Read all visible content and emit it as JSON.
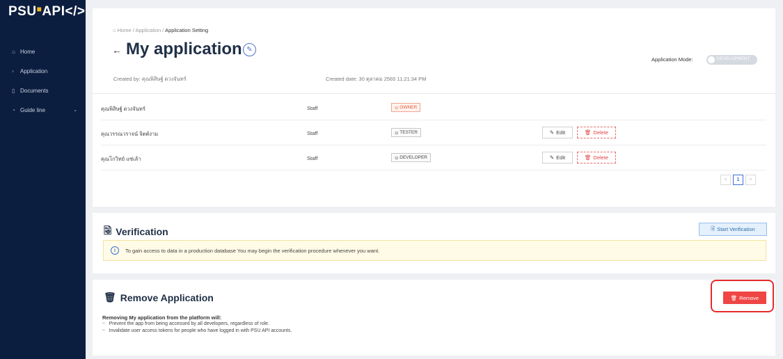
{
  "sidebar": {
    "logo": "PSU",
    "logo_suffix": "API</>",
    "items": [
      {
        "label": "Home",
        "icon": "home-icon"
      },
      {
        "label": "Application",
        "icon": "app-icon"
      },
      {
        "label": "Documents",
        "icon": "document-icon"
      },
      {
        "label": "Guide line",
        "icon": "clock-icon"
      }
    ]
  },
  "header": {
    "breadcrumb": {
      "home": "Home",
      "sep1": "/",
      "application": "Application",
      "sep2": "/",
      "current": "Application Setting"
    },
    "title": "My application",
    "created_by_label": "Created by:",
    "created_by_value": "คุณพิสิษฐ์ ดวงจันทร์",
    "created_date_label": "Created date:",
    "created_date_value": "30 ตุลาคม 2565 11:21:34 PM",
    "mode_label": "Application Mode:",
    "mode_value": "DEVELOPMENT"
  },
  "members": {
    "rows": [
      {
        "name": "คุณพิสิษฐ์ ดวงจันทร์",
        "role": "Staff",
        "tag": "OWNER",
        "editable": false
      },
      {
        "name": "คุณวรรณวราจน์ จิตต์งาม",
        "role": "Staff",
        "tag": "TESTER",
        "editable": true
      },
      {
        "name": "คุณโกวิทย์ แซ่เล้า",
        "role": "Staff",
        "tag": "DEVELOPER",
        "editable": true
      }
    ],
    "edit_label": "Edit",
    "delete_label": "Delete",
    "pagination": {
      "prev": "<",
      "current": "1",
      "next": ">"
    }
  },
  "verification": {
    "title": "Verification",
    "button": "Start Verification",
    "alert": "To gain access to data in a production database You may begin the verification procedure whenever you want."
  },
  "remove": {
    "title": "Remove Application",
    "button": "Remove",
    "heading": "Removing My application from the platform will:",
    "bullets": [
      "Prevent the app from being accessed by all developers, regardless of role.",
      "Invalidate user access tokens for people who have logged in with PSU API accounts."
    ]
  },
  "colors": {
    "sidebar": "#0c1e3f",
    "danger": "#ef4545",
    "accent": "#3c6fd6"
  }
}
